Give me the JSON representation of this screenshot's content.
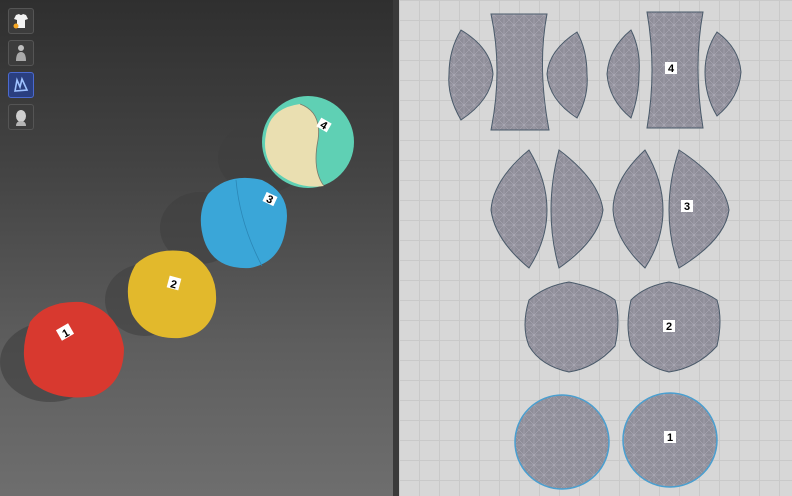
{
  "toolbar": {
    "tools": [
      {
        "name": "garment-icon"
      },
      {
        "name": "avatar-body-icon"
      },
      {
        "name": "pattern-icon"
      },
      {
        "name": "avatar-head-icon"
      }
    ]
  },
  "balls3d": [
    {
      "label": "1",
      "color": "#d8392f"
    },
    {
      "label": "2",
      "color": "#e2b92c"
    },
    {
      "label": "3",
      "color": "#3aa6d8"
    },
    {
      "label": "4",
      "color": "#5fd0b4"
    }
  ],
  "patterns": [
    {
      "label": "4"
    },
    {
      "label": "3"
    },
    {
      "label": "2"
    },
    {
      "label": "1"
    }
  ],
  "colors": {
    "mesh_fill": "#8f8e99",
    "mesh_line": "#b9b9c4",
    "outline": "#4a9fd0"
  }
}
